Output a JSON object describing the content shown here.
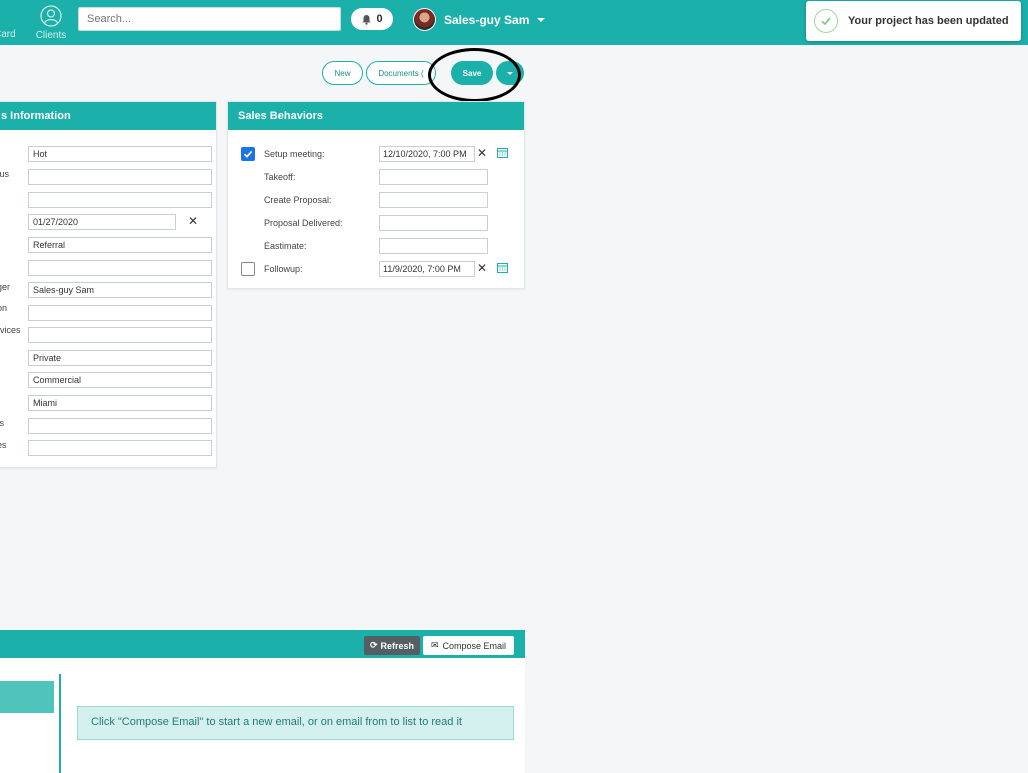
{
  "header": {
    "nav_card_label": "Card",
    "nav_clients_label": "Clients",
    "search_placeholder": "Search...",
    "notifications_count": "0",
    "user_name": "Sales-guy Sam"
  },
  "toast": {
    "message": "Your project has been updated"
  },
  "actions": {
    "new_label": "New",
    "documents_label": "Documents (",
    "save_label": "Save"
  },
  "left_panel": {
    "title": "s Information",
    "rows": [
      {
        "label": "",
        "value": "Hot"
      },
      {
        "label": "tus",
        "value": ""
      },
      {
        "label": "",
        "value": ""
      },
      {
        "label": "",
        "value": "01/27/2020"
      },
      {
        "label": "",
        "value": "Referral"
      },
      {
        "label": "",
        "value": ""
      },
      {
        "label": "ger",
        "value": "Sales-guy Sam"
      },
      {
        "label": "on",
        "value": ""
      },
      {
        "label": "rvices",
        "value": ""
      },
      {
        "label": "",
        "value": "Private"
      },
      {
        "label": "",
        "value": "Commercial"
      },
      {
        "label": "",
        "value": "Miami"
      },
      {
        "label": "ts",
        "value": ""
      },
      {
        "label": "es",
        "value": ""
      }
    ]
  },
  "sales_behaviors": {
    "title": "Sales Behaviors",
    "rows": [
      {
        "label": "Setup meeting:",
        "value": "12/10/2020, 7:00 PM",
        "checked": true
      },
      {
        "label": "Takeoff:",
        "value": ""
      },
      {
        "label": "Create Proposal:",
        "value": ""
      },
      {
        "label": "Proposal Delivered:",
        "value": ""
      },
      {
        "label": "Eastimate:",
        "value": ""
      },
      {
        "label": "Followup:",
        "value": "11/9/2020, 7:00 PM",
        "checked": false
      }
    ]
  },
  "email": {
    "refresh_label": "Refresh",
    "compose_label": "Compose Email",
    "info_text": "Click \"Compose Email\" to start a new email, or on email from to list to read it"
  },
  "colors": {
    "accent": "#1cb0aa",
    "checkbox": "#1e73e8"
  }
}
